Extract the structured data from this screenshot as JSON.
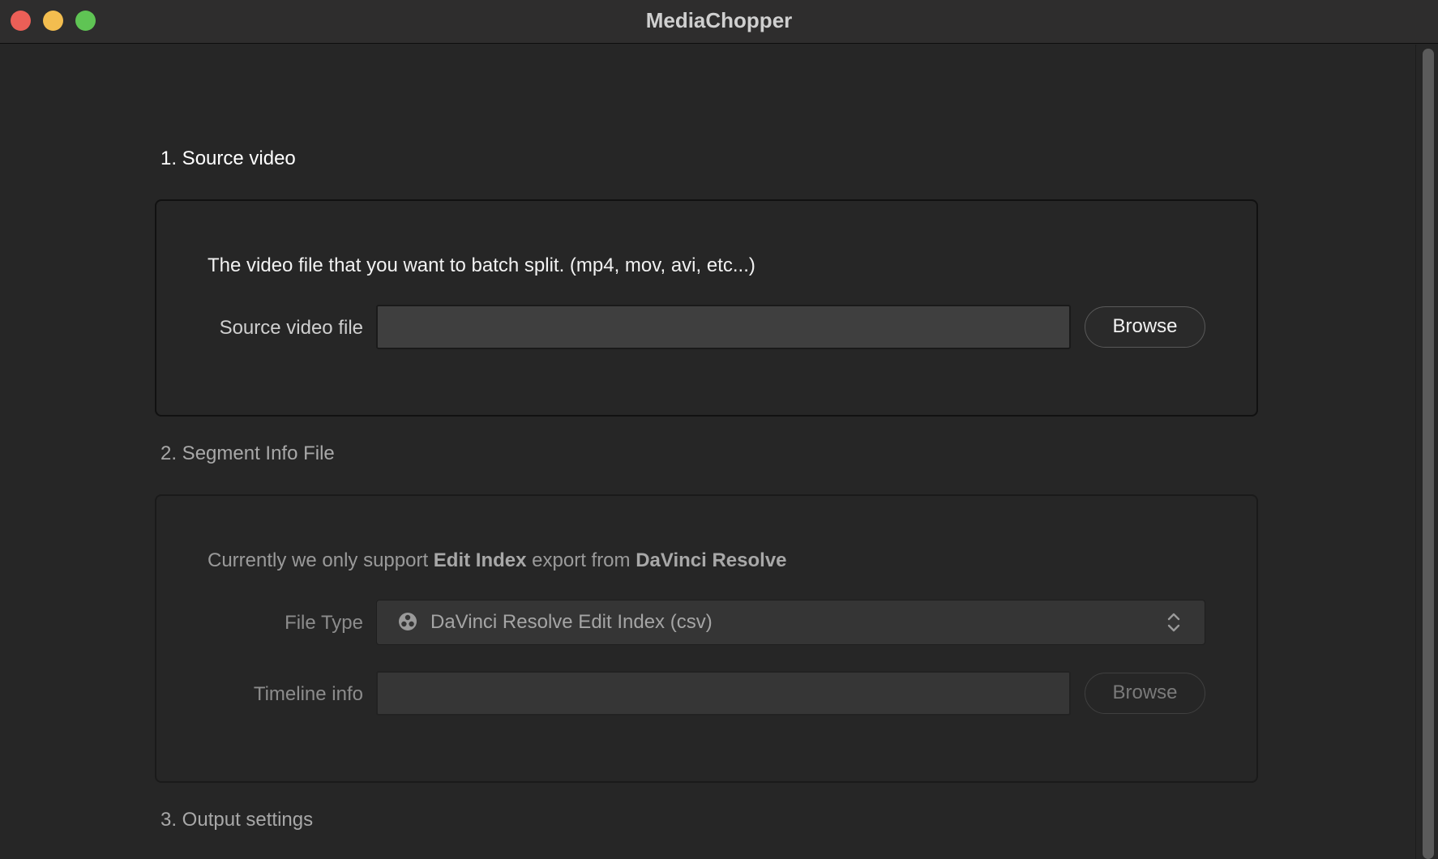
{
  "window": {
    "title": "MediaChopper"
  },
  "sections": {
    "source": {
      "title": "1. Source video",
      "description": "The video file that you want to batch split. (mp4, mov, avi, etc...)",
      "field_label": "Source video file",
      "field_value": "",
      "browse_label": "Browse"
    },
    "segment": {
      "title": "2. Segment Info File",
      "description_prefix": "Currently we only support ",
      "description_bold1": "Edit Index",
      "description_mid": " export from ",
      "description_bold2": "DaVinci Resolve",
      "file_type_label": "File Type",
      "file_type_value": "DaVinci Resolve Edit Index (csv)",
      "file_type_icon": "davinci-resolve-icon",
      "timeline_label": "Timeline info",
      "timeline_value": "",
      "browse_label": "Browse"
    },
    "output": {
      "title": "3. Output settings"
    }
  },
  "colors": {
    "close": "#ec5f57",
    "minimize": "#f3bd4f",
    "maximize": "#5fc454",
    "background": "#262626"
  }
}
